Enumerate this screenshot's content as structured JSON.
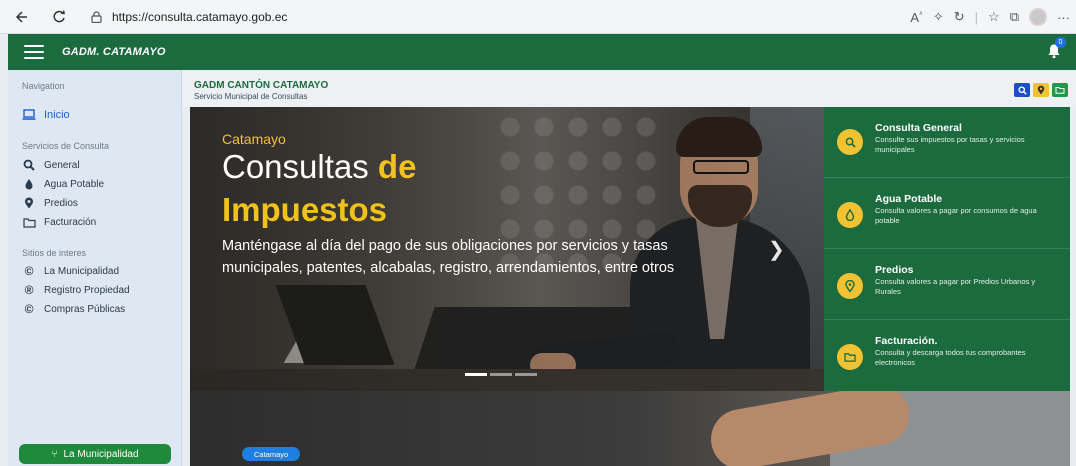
{
  "browser": {
    "url": "https://consulta.catamayo.gob.ec"
  },
  "app": {
    "title": "GADM. CATAMAYO",
    "notifications": "0"
  },
  "sidebar": {
    "nav_heading": "Navigation",
    "inicio": "Inicio",
    "servicios_heading": "Servicios de Consulta",
    "servicios": [
      {
        "label": "General",
        "icon": "search-icon"
      },
      {
        "label": "Agua Potable",
        "icon": "water-drop-icon"
      },
      {
        "label": "Predios",
        "icon": "map-pin-icon"
      },
      {
        "label": "Facturación",
        "icon": "folder-icon"
      }
    ],
    "sitios_heading": "Sitios de interes",
    "sitios": [
      {
        "label": "La Municipalidad",
        "icon": "copyright-circle-icon"
      },
      {
        "label": "Registro Propiedad",
        "icon": "registered-circle-icon"
      },
      {
        "label": "Compras Públicas",
        "icon": "copyright-circle-icon"
      }
    ],
    "footer_button": "La Municipalidad"
  },
  "content": {
    "org_title": "GADM CANTÓN CATAMAYO",
    "org_subtitle": "Servicio Municipal de Consultas"
  },
  "hero": {
    "small_title": "Catamayo",
    "title_part1": "Consultas",
    "title_part2": "de",
    "title_line2": "Impuestos",
    "description": "Manténgase al día del pago de sus obligaciones por servicios y tasas municipales, patentes, alcabalas, registro, arrendamientos, entre otros"
  },
  "services_panel": [
    {
      "title": "Consulta General",
      "desc": "Consulte sus impuestos por tasas y servicios municipales",
      "icon": "search-icon"
    },
    {
      "title": "Agua Potable",
      "desc": "Consulta valores a pagar por consumos de agua potable",
      "icon": "water-drop-icon"
    },
    {
      "title": "Predios",
      "desc": "Consulta valores a pagar por Predios Urbanos y Rurales",
      "icon": "map-pin-icon"
    },
    {
      "title": "Facturación.",
      "desc": "Consulta y descarga todos tus comprobantes electronicos",
      "icon": "folder-icon"
    }
  ],
  "banner2": {
    "pill": "Catamayo"
  },
  "colors": {
    "brand_green": "#1c6b3f",
    "accent_yellow": "#f1c232",
    "link_blue": "#1d5fd6"
  }
}
